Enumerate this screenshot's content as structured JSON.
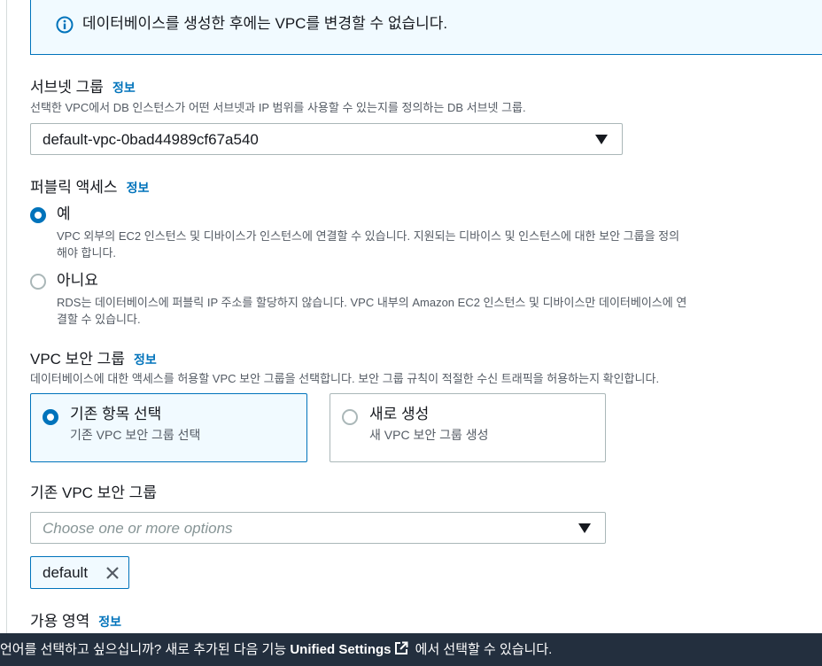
{
  "info_banner": {
    "text": "데이터베이스를 생성한 후에는 VPC를 변경할 수 없습니다."
  },
  "subnet_group": {
    "label": "서브넷 그룹",
    "info_link": "정보",
    "description": "선택한 VPC에서 DB 인스턴스가 어떤 서브넷과 IP 범위를 사용할 수 있는지를 정의하는 DB 서브넷 그룹.",
    "selected_value": "default-vpc-0bad44989cf67a540"
  },
  "public_access": {
    "label": "퍼블릭 액세스",
    "info_link": "정보",
    "options": [
      {
        "label": "예",
        "checked": true,
        "description_line1": "VPC 외부의 EC2 인스턴스 및 디바이스가 인스턴스에 연결할 수 있습니다. 지원되는 디바이스 및 인스턴스에 대한 보안 그룹을 정의",
        "description_line2": "해야 합니다."
      },
      {
        "label": "아니요",
        "checked": false,
        "description_line1": "RDS는 데이터베이스에 퍼블릭 IP 주소를 할당하지 않습니다. VPC 내부의 Amazon EC2 인스턴스 및 디바이스만 데이터베이스에 연",
        "description_line2": "결할 수 있습니다."
      }
    ]
  },
  "vpc_security_group": {
    "label": "VPC 보안 그룹",
    "info_link": "정보",
    "description": "데이터베이스에 대한 액세스를 허용할 VPC 보안 그룹을 선택합니다. 보안 그룹 규칙이 적절한 수신 트래픽을 허용하는지 확인합니다.",
    "tiles": [
      {
        "title": "기존 항목 선택",
        "description": "기존 VPC 보안 그룹 선택",
        "selected": true
      },
      {
        "title": "새로 생성",
        "description": "새 VPC 보안 그룹 생성",
        "selected": false
      }
    ]
  },
  "existing_security_groups": {
    "label": "기존 VPC 보안 그룹",
    "placeholder": "Choose one or more options",
    "tokens": [
      "default"
    ]
  },
  "availability_zone": {
    "label": "가용 영역",
    "info_link": "정보"
  },
  "footer": {
    "text_before": "언어를 선택하고 싶으십니까? 새로 추가된 다음 기능 ",
    "link_text": "Unified Settings",
    "text_after": " 에서 선택할 수 있습니다."
  },
  "colors": {
    "accent": "#0073bb",
    "info_background": "#f1faff",
    "footer_background": "#232f3e",
    "description_text": "#545b64"
  }
}
